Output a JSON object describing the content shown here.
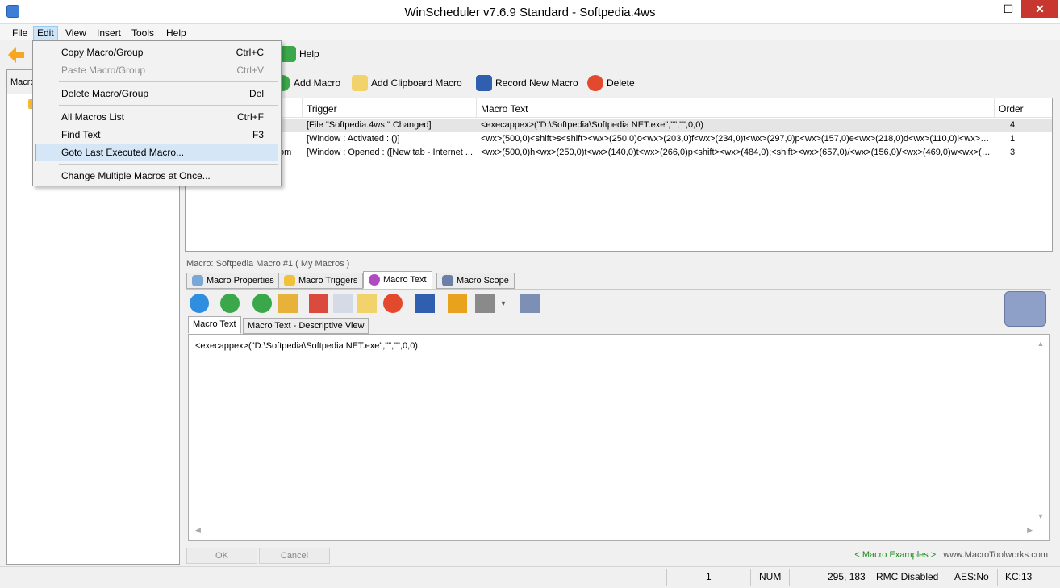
{
  "window": {
    "title": "WinScheduler v7.6.9 Standard - Softpedia.4ws",
    "minimize": "—",
    "maximize": "☐",
    "close": "✕"
  },
  "menubar": [
    "File",
    "Edit",
    "View",
    "Insert",
    "Tools",
    "Help"
  ],
  "toolbar1": {
    "help": "Help"
  },
  "toolbar2": {
    "add_macro": "Add Macro",
    "add_clipboard_macro": "Add Clipboard Macro",
    "record_new_macro": "Record New Macro",
    "delete": "Delete"
  },
  "left_panel": {
    "header": "Macro"
  },
  "grid": {
    "columns": {
      "trigger": "Trigger",
      "macro_text": "Macro Text",
      "order": "Order"
    },
    "rows": [
      {
        "name": "",
        "trigger": "[File \"Softpedia.4ws \" Changed]",
        "macro_text": "<execappex>(\"D:\\Softpedia\\Softpedia NET.exe\",\"\",\"\",0,0)",
        "order": "4"
      },
      {
        "name": "",
        "trigger": "[Window : Activated : ()]",
        "macro_text": "<wx>(500,0)<shift>s<shift><wx>(250,0)o<wx>(203,0)f<wx>(234,0)t<wx>(297,0)p<wx>(157,0)e<wx>(218,0)d<wx>(110,0)i<wx>(172,0)...",
        "order": "1"
      },
      {
        "name": "om",
        "trigger": "[Window : Opened : ([New tab - Internet ...",
        "macro_text": "<wx>(500,0)h<wx>(250,0)t<wx>(140,0)t<wx>(266,0)p<shift><wx>(484,0);<shift><wx>(657,0)/<wx>(156,0)/<wx>(469,0)w<wx>(234,0...",
        "order": "3"
      }
    ]
  },
  "macro_panel": {
    "label": "Macro: Softpedia Macro #1 ( My Macros )",
    "tabs": [
      "Macro Properties",
      "Macro Triggers",
      "Macro Text",
      "Macro Scope"
    ],
    "subtabs": [
      "Macro Text",
      "Macro Text - Descriptive View"
    ],
    "editor_text": "<execappex>(\"D:\\Softpedia\\Softpedia NET.exe\",\"\",\"\",0,0)"
  },
  "bottom": {
    "ok": "OK",
    "cancel": "Cancel",
    "macro_examples": "< Macro Examples >",
    "website": "www.MacroToolworks.com"
  },
  "statusbar": {
    "count": "1",
    "num": "NUM",
    "coords": "295, 183",
    "rmc": "RMC Disabled",
    "aes": "AES:No",
    "kc": "KC:13"
  },
  "edit_menu": [
    {
      "label": "Copy Macro/Group",
      "shortcut": "Ctrl+C",
      "disabled": false
    },
    {
      "label": "Paste Macro/Group",
      "shortcut": "Ctrl+V",
      "disabled": true
    },
    {
      "label": "Delete Macro/Group",
      "shortcut": "Del",
      "disabled": false
    },
    {
      "label": "All Macros List",
      "shortcut": "Ctrl+F",
      "disabled": false
    },
    {
      "label": "Find Text",
      "shortcut": "F3",
      "disabled": false
    },
    {
      "label": "Goto Last Executed Macro...",
      "shortcut": "",
      "disabled": false
    },
    {
      "label": "Change Multiple Macros at Once...",
      "shortcut": "",
      "disabled": false
    }
  ],
  "colors": {
    "accent": "#3d7fd6",
    "close_red": "#c7372f",
    "link_green": "#1b8a1b",
    "highlight": "#d5e6f7"
  }
}
